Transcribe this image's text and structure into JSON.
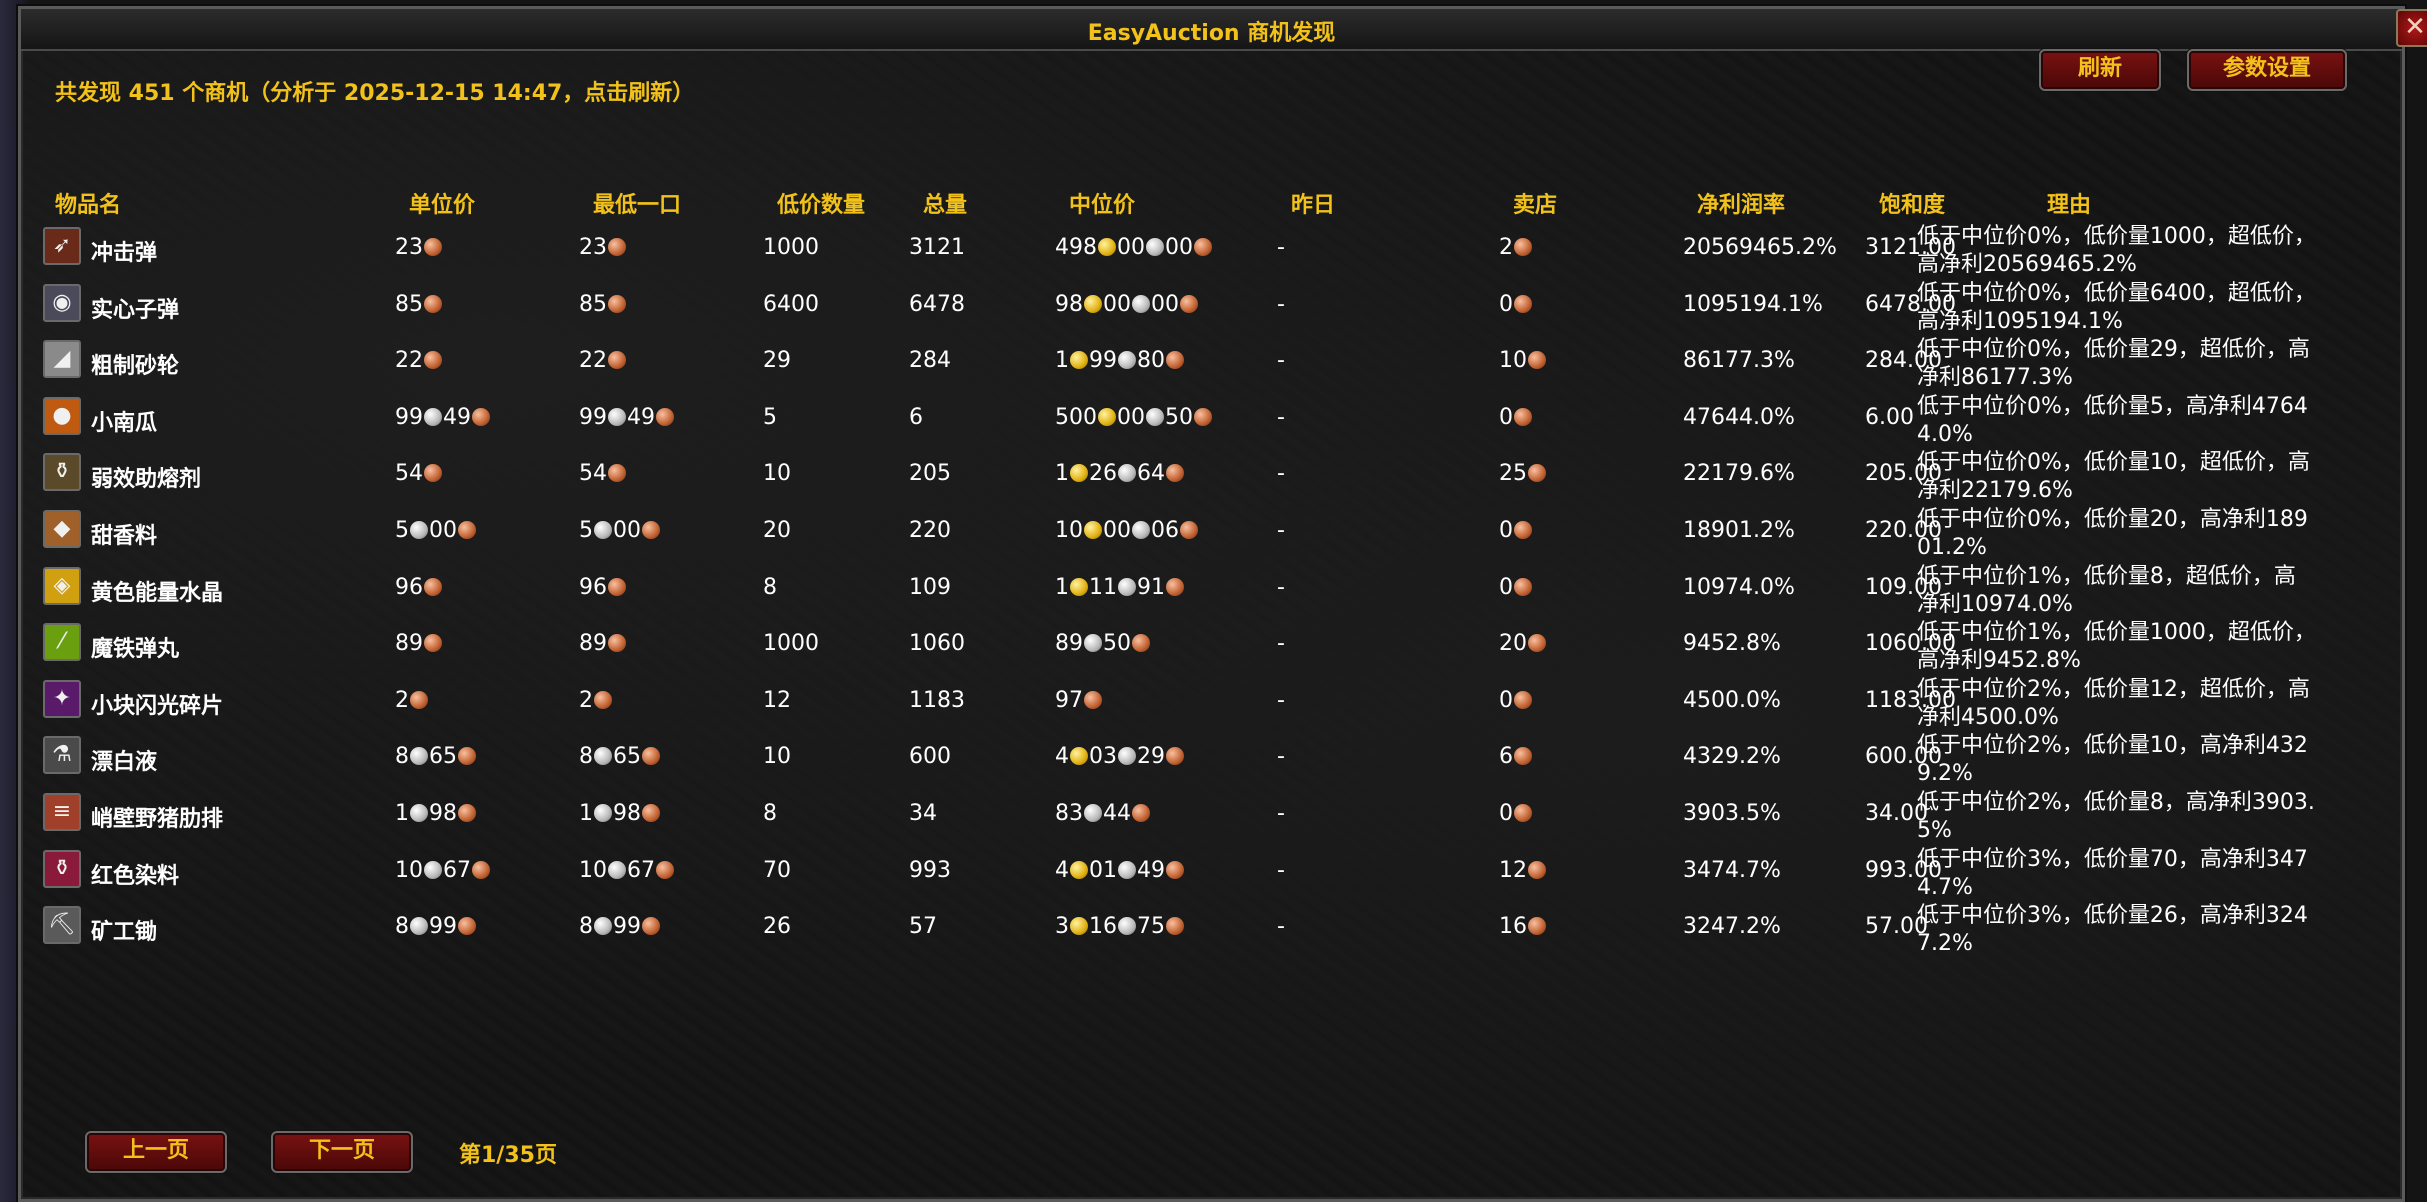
{
  "window": {
    "title": "EasyAuction 商机发现",
    "close_label": "✕"
  },
  "summary": "共发现 451 个商机（分析于 2025-12-15 14:47，点击刷新）",
  "toolbar": {
    "refresh_label": "刷新",
    "settings_label": "参数设置"
  },
  "columns": {
    "name": "物品名",
    "unit_price": "单位价",
    "buyout": "最低一口",
    "low_qty": "低价数量",
    "total": "总量",
    "median": "中位价",
    "yesterday": "昨日",
    "vendor": "卖店",
    "profit_rate": "净利润率",
    "saturation": "饱和度",
    "reason": "理由"
  },
  "rows": [
    {
      "name": "冲击弹",
      "icon": "shock-bullet-icon",
      "glyph": "➶",
      "bg": "#6a2a1a",
      "unit": [
        [
          "23",
          "copper"
        ]
      ],
      "buyout": [
        [
          "23",
          "copper"
        ]
      ],
      "low_qty": "1000",
      "total": "3121",
      "median": [
        [
          "498",
          "gold"
        ],
        [
          "00",
          "silver"
        ],
        [
          "00",
          "copper"
        ]
      ],
      "yesterday": "-",
      "vendor": [
        [
          "2",
          "copper"
        ]
      ],
      "rate": "20569465.2%",
      "sat": "3121.00",
      "reason": "低于中位价0%，低价量1000，超低价，高净利20569465.2%"
    },
    {
      "name": "实心子弹",
      "icon": "solid-bullet-icon",
      "glyph": "◉",
      "bg": "#4a4a5a",
      "unit": [
        [
          "85",
          "copper"
        ]
      ],
      "buyout": [
        [
          "85",
          "copper"
        ]
      ],
      "low_qty": "6400",
      "total": "6478",
      "median": [
        [
          "98",
          "gold"
        ],
        [
          "00",
          "silver"
        ],
        [
          "00",
          "copper"
        ]
      ],
      "yesterday": "-",
      "vendor": [
        [
          "0",
          "copper"
        ]
      ],
      "rate": "1095194.1%",
      "sat": "6478.00",
      "reason": "低于中位价0%，低价量6400，超低价，高净利1095194.1%"
    },
    {
      "name": "粗制砂轮",
      "icon": "grinding-stone-icon",
      "glyph": "◢",
      "bg": "#8a8a8a",
      "unit": [
        [
          "22",
          "copper"
        ]
      ],
      "buyout": [
        [
          "22",
          "copper"
        ]
      ],
      "low_qty": "29",
      "total": "284",
      "median": [
        [
          "1",
          "gold"
        ],
        [
          "99",
          "silver"
        ],
        [
          "80",
          "copper"
        ]
      ],
      "yesterday": "-",
      "vendor": [
        [
          "10",
          "copper"
        ]
      ],
      "rate": "86177.3%",
      "sat": "284.00",
      "reason": "低于中位价0%，低价量29，超低价，高净利86177.3%"
    },
    {
      "name": "小南瓜",
      "icon": "pumpkin-icon",
      "glyph": "●",
      "bg": "#c05a10",
      "unit": [
        [
          "99",
          "silver"
        ],
        [
          "49",
          "copper"
        ]
      ],
      "buyout": [
        [
          "99",
          "silver"
        ],
        [
          "49",
          "copper"
        ]
      ],
      "low_qty": "5",
      "total": "6",
      "median": [
        [
          "500",
          "gold"
        ],
        [
          "00",
          "silver"
        ],
        [
          "50",
          "copper"
        ]
      ],
      "yesterday": "-",
      "vendor": [
        [
          "0",
          "copper"
        ]
      ],
      "rate": "47644.0%",
      "sat": "6.00",
      "reason": "低于中位价0%，低价量5，高净利47644.0%"
    },
    {
      "name": "弱效助熔剂",
      "icon": "flux-icon",
      "glyph": "⚱",
      "bg": "#5a4a2a",
      "unit": [
        [
          "54",
          "copper"
        ]
      ],
      "buyout": [
        [
          "54",
          "copper"
        ]
      ],
      "low_qty": "10",
      "total": "205",
      "median": [
        [
          "1",
          "gold"
        ],
        [
          "26",
          "silver"
        ],
        [
          "64",
          "copper"
        ]
      ],
      "yesterday": "-",
      "vendor": [
        [
          "25",
          "copper"
        ]
      ],
      "rate": "22179.6%",
      "sat": "205.00",
      "reason": "低于中位价0%，低价量10，超低价，高净利22179.6%"
    },
    {
      "name": "甜香料",
      "icon": "sweet-spice-icon",
      "glyph": "◆",
      "bg": "#a0602a",
      "unit": [
        [
          "5",
          "silver"
        ],
        [
          "00",
          "copper"
        ]
      ],
      "buyout": [
        [
          "5",
          "silver"
        ],
        [
          "00",
          "copper"
        ]
      ],
      "low_qty": "20",
      "total": "220",
      "median": [
        [
          "10",
          "gold"
        ],
        [
          "00",
          "silver"
        ],
        [
          "06",
          "copper"
        ]
      ],
      "yesterday": "-",
      "vendor": [
        [
          "0",
          "copper"
        ]
      ],
      "rate": "18901.2%",
      "sat": "220.00",
      "reason": "低于中位价0%，低价量20，高净利18901.2%"
    },
    {
      "name": "黄色能量水晶",
      "icon": "yellow-crystal-icon",
      "glyph": "◈",
      "bg": "#d0a010",
      "unit": [
        [
          "96",
          "copper"
        ]
      ],
      "buyout": [
        [
          "96",
          "copper"
        ]
      ],
      "low_qty": "8",
      "total": "109",
      "median": [
        [
          "1",
          "gold"
        ],
        [
          "11",
          "silver"
        ],
        [
          "91",
          "copper"
        ]
      ],
      "yesterday": "-",
      "vendor": [
        [
          "0",
          "copper"
        ]
      ],
      "rate": "10974.0%",
      "sat": "109.00",
      "reason": "低于中位价1%，低价量8，超低价，高净利10974.0%"
    },
    {
      "name": "魔铁弹丸",
      "icon": "thorium-shell-icon",
      "glyph": "⁄",
      "bg": "#6aa010",
      "unit": [
        [
          "89",
          "copper"
        ]
      ],
      "buyout": [
        [
          "89",
          "copper"
        ]
      ],
      "low_qty": "1000",
      "total": "1060",
      "median": [
        [
          "89",
          "silver"
        ],
        [
          "50",
          "copper"
        ]
      ],
      "yesterday": "-",
      "vendor": [
        [
          "20",
          "copper"
        ]
      ],
      "rate": "9452.8%",
      "sat": "1060.00",
      "reason": "低于中位价1%，低价量1000，超低价，高净利9452.8%"
    },
    {
      "name": "小块闪光碎片",
      "icon": "shard-icon",
      "glyph": "✦",
      "bg": "#5a1a6a",
      "unit": [
        [
          "2",
          "copper"
        ]
      ],
      "buyout": [
        [
          "2",
          "copper"
        ]
      ],
      "low_qty": "12",
      "total": "1183",
      "median": [
        [
          "97",
          "copper"
        ]
      ],
      "yesterday": "-",
      "vendor": [
        [
          "0",
          "copper"
        ]
      ],
      "rate": "4500.0%",
      "sat": "1183.00",
      "reason": "低于中位价2%，低价量12，超低价，高净利4500.0%"
    },
    {
      "name": "漂白液",
      "icon": "bleach-icon",
      "glyph": "⚗",
      "bg": "#4a4a4a",
      "unit": [
        [
          "8",
          "silver"
        ],
        [
          "65",
          "copper"
        ]
      ],
      "buyout": [
        [
          "8",
          "silver"
        ],
        [
          "65",
          "copper"
        ]
      ],
      "low_qty": "10",
      "total": "600",
      "median": [
        [
          "4",
          "gold"
        ],
        [
          "03",
          "silver"
        ],
        [
          "29",
          "copper"
        ]
      ],
      "yesterday": "-",
      "vendor": [
        [
          "6",
          "copper"
        ]
      ],
      "rate": "4329.2%",
      "sat": "600.00",
      "reason": "低于中位价2%，低价量10，高净利4329.2%"
    },
    {
      "name": "峭壁野猪肋排",
      "icon": "boar-ribs-icon",
      "glyph": "≡",
      "bg": "#a0402a",
      "unit": [
        [
          "1",
          "silver"
        ],
        [
          "98",
          "copper"
        ]
      ],
      "buyout": [
        [
          "1",
          "silver"
        ],
        [
          "98",
          "copper"
        ]
      ],
      "low_qty": "8",
      "total": "34",
      "median": [
        [
          "83",
          "silver"
        ],
        [
          "44",
          "copper"
        ]
      ],
      "yesterday": "-",
      "vendor": [
        [
          "0",
          "copper"
        ]
      ],
      "rate": "3903.5%",
      "sat": "34.00",
      "reason": "低于中位价2%，低价量8，高净利3903.5%"
    },
    {
      "name": "红色染料",
      "icon": "red-dye-icon",
      "glyph": "⚱",
      "bg": "#8a1a3a",
      "unit": [
        [
          "10",
          "silver"
        ],
        [
          "67",
          "copper"
        ]
      ],
      "buyout": [
        [
          "10",
          "silver"
        ],
        [
          "67",
          "copper"
        ]
      ],
      "low_qty": "70",
      "total": "993",
      "median": [
        [
          "4",
          "gold"
        ],
        [
          "01",
          "silver"
        ],
        [
          "49",
          "copper"
        ]
      ],
      "yesterday": "-",
      "vendor": [
        [
          "12",
          "copper"
        ]
      ],
      "rate": "3474.7%",
      "sat": "993.00",
      "reason": "低于中位价3%，低价量70，高净利3474.7%"
    },
    {
      "name": "矿工锄",
      "icon": "mining-pick-icon",
      "glyph": "⛏",
      "bg": "#5a5a5a",
      "unit": [
        [
          "8",
          "silver"
        ],
        [
          "99",
          "copper"
        ]
      ],
      "buyout": [
        [
          "8",
          "silver"
        ],
        [
          "99",
          "copper"
        ]
      ],
      "low_qty": "26",
      "total": "57",
      "median": [
        [
          "3",
          "gold"
        ],
        [
          "16",
          "silver"
        ],
        [
          "75",
          "copper"
        ]
      ],
      "yesterday": "-",
      "vendor": [
        [
          "16",
          "copper"
        ]
      ],
      "rate": "3247.2%",
      "sat": "57.00",
      "reason": "低于中位价3%，低价量26，高净利3247.2%"
    }
  ],
  "pagination": {
    "prev_label": "上一页",
    "next_label": "下一页",
    "page_info": "第1/35页"
  }
}
